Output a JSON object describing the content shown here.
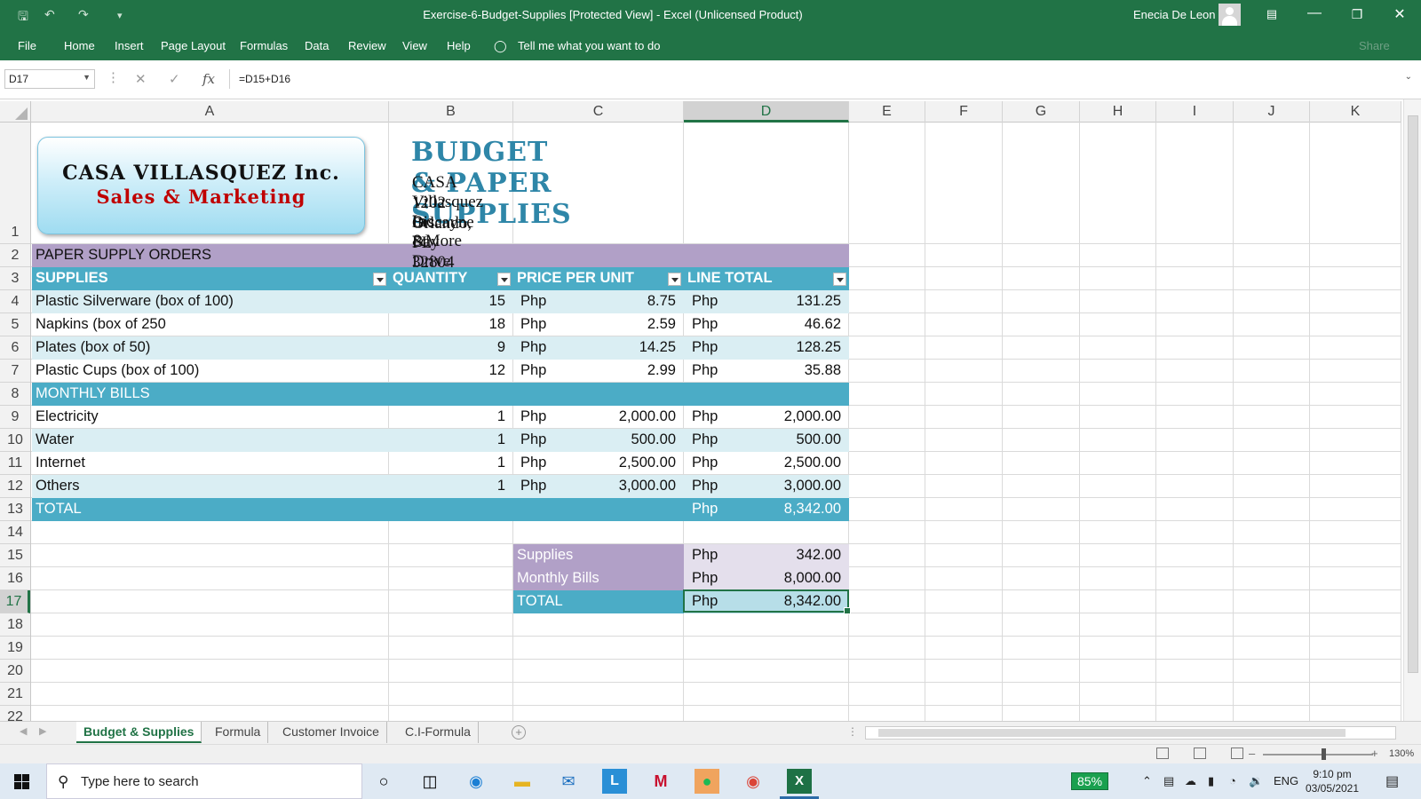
{
  "window": {
    "title": "Exercise-6-Budget-Supplies  [Protected View]  -  Excel (Unlicensed Product)",
    "user": "Enecia De Leon"
  },
  "menu": [
    "File",
    "Home",
    "Insert",
    "Page Layout",
    "Formulas",
    "Data",
    "Review",
    "View",
    "Help"
  ],
  "tell_me": "Tell me what you want to do",
  "share": "Share",
  "formula_bar": {
    "name_box": "D17",
    "formula": "=D15+D16"
  },
  "columns": [
    "A",
    "B",
    "C",
    "D",
    "E",
    "F",
    "G",
    "H",
    "I",
    "J",
    "K"
  ],
  "active_column": "D",
  "rows": [
    "1",
    "2",
    "3",
    "4",
    "5",
    "6",
    "7",
    "8",
    "9",
    "10",
    "11",
    "12",
    "13",
    "14",
    "15",
    "16",
    "17",
    "18",
    "19",
    "20",
    "21",
    "22"
  ],
  "active_row": "17",
  "logo": {
    "line1": "CASA VILLASQUEZ Inc.",
    "line2": "Sales & Marketing"
  },
  "heading": {
    "title": "BUDGET & PAPER SUPPLIES",
    "address": [
      "CASA Villasquez Inc. &More",
      "1202 Biscayne Bay Drive",
      "Orlando, FL 32804"
    ]
  },
  "section_supplies": "PAPER  SUPPLY ORDERS",
  "table_headers": [
    "SUPPLIES",
    "QUANTITY",
    "PRICE PER UNIT",
    "LINE TOTAL"
  ],
  "currency": "Php",
  "supplies": [
    {
      "item": "Plastic Silverware (box of 100)",
      "qty": "15",
      "price": "8.75",
      "total": "131.25"
    },
    {
      "item": "Napkins (box of 250",
      "qty": "18",
      "price": "2.59",
      "total": "46.62"
    },
    {
      "item": "Plates (box of 50)",
      "qty": "9",
      "price": "14.25",
      "total": "128.25"
    },
    {
      "item": "Plastic Cups (box of 100)",
      "qty": "12",
      "price": "2.99",
      "total": "35.88"
    }
  ],
  "section_bills": "MONTHLY BILLS",
  "bills": [
    {
      "item": "Electricity",
      "qty": "1",
      "price": "2,000.00",
      "total": "2,000.00"
    },
    {
      "item": "Water",
      "qty": "1",
      "price": "500.00",
      "total": "500.00"
    },
    {
      "item": "Internet",
      "qty": "1",
      "price": "2,500.00",
      "total": "2,500.00"
    },
    {
      "item": "Others",
      "qty": "1",
      "price": "3,000.00",
      "total": "3,000.00"
    }
  ],
  "total_row": {
    "label": "TOTAL",
    "total": "8,342.00"
  },
  "summary": [
    {
      "label": "Supplies",
      "value": "342.00"
    },
    {
      "label": "Monthly Bills",
      "value": "8,000.00"
    },
    {
      "label": "TOTAL",
      "value": "8,342.00"
    }
  ],
  "sheets": [
    "Budget & Supplies",
    "Formula",
    "Customer Invoice",
    "C.I-Formula"
  ],
  "active_sheet": "Budget & Supplies",
  "zoom": "130%",
  "taskbar": {
    "search_placeholder": "Type here to search",
    "battery": "85%",
    "language": "ENG",
    "time": "9:10 pm",
    "date": "03/05/2021"
  },
  "colors": {
    "excel_green": "#217346",
    "header_teal": "#4bacc6",
    "purple_band": "#b1a0c7",
    "light_row": "#daeef3",
    "lavender": "#e4dfec",
    "title_blue": "#2e86a8",
    "logo_red": "#c00000"
  }
}
